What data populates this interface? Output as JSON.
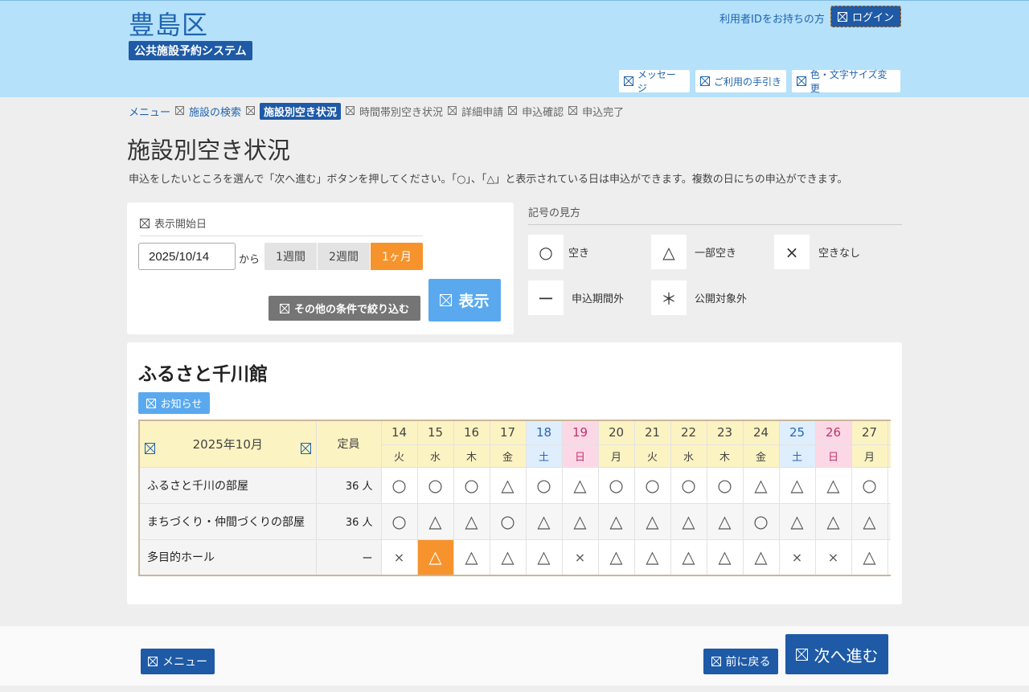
{
  "header": {
    "title": "豊島区",
    "subtitle": "公共施設予約システム",
    "userid_text": "利用者IDをお持ちの方",
    "login_label": "ログイン",
    "buttons": [
      "メッセージ",
      "ご利用の手引き",
      "色・文字サイズ変更"
    ]
  },
  "breadcrumb": [
    {
      "label": "メニュー",
      "state": "link"
    },
    {
      "label": "施設の検索",
      "state": "link"
    },
    {
      "label": "施設別空き状況",
      "state": "current"
    },
    {
      "label": "時間帯別空き状況",
      "state": "todo"
    },
    {
      "label": "詳細申請",
      "state": "todo"
    },
    {
      "label": "申込確認",
      "state": "todo"
    },
    {
      "label": "申込完了",
      "state": "todo"
    }
  ],
  "page": {
    "title": "施設別空き状況",
    "lead": "申込をしたいところを選んで「次へ進む」ボタンを押してください。「○」、「△」と表示されている日は申込ができます。複数の日にちの申込ができます。"
  },
  "date_panel": {
    "heading": "表示開始日",
    "date_value": "2025/10/14",
    "kara": "から",
    "periods": [
      {
        "label": "1週間",
        "active": false
      },
      {
        "label": "2週間",
        "active": false
      },
      {
        "label": "1ヶ月",
        "active": true
      }
    ],
    "filter_label": "その他の条件で絞り込む",
    "show_label": "表示"
  },
  "legend": {
    "title": "記号の見方",
    "items": [
      {
        "symbol": "○",
        "label": "空き"
      },
      {
        "symbol": "△",
        "label": "一部空き"
      },
      {
        "symbol": "×",
        "label": "空きなし"
      },
      {
        "symbol": "ー",
        "label": "申込期間外"
      },
      {
        "symbol": "＊",
        "label": "公開対象外"
      }
    ]
  },
  "facility": {
    "name": "ふるさと千川館",
    "notice_label": "お知らせ",
    "month_label": "2025年10月",
    "capacity_header": "定員",
    "days": [
      {
        "d": "14",
        "w": "火",
        "type": ""
      },
      {
        "d": "15",
        "w": "水",
        "type": ""
      },
      {
        "d": "16",
        "w": "木",
        "type": ""
      },
      {
        "d": "17",
        "w": "金",
        "type": ""
      },
      {
        "d": "18",
        "w": "土",
        "type": "sat"
      },
      {
        "d": "19",
        "w": "日",
        "type": "sun"
      },
      {
        "d": "20",
        "w": "月",
        "type": ""
      },
      {
        "d": "21",
        "w": "火",
        "type": ""
      },
      {
        "d": "22",
        "w": "水",
        "type": ""
      },
      {
        "d": "23",
        "w": "木",
        "type": ""
      },
      {
        "d": "24",
        "w": "金",
        "type": ""
      },
      {
        "d": "25",
        "w": "土",
        "type": "sat"
      },
      {
        "d": "26",
        "w": "日",
        "type": "sun"
      },
      {
        "d": "27",
        "w": "月",
        "type": ""
      },
      {
        "d": "",
        "w": "",
        "type": ""
      }
    ],
    "rows": [
      {
        "name": "ふるさと千川の部屋",
        "capacity": "36 人",
        "marks": [
          "○",
          "○",
          "○",
          "△",
          "○",
          "△",
          "○",
          "○",
          "○",
          "○",
          "△",
          "△",
          "△",
          "○",
          ""
        ]
      },
      {
        "name": "まちづくり・仲間づくりの部屋",
        "capacity": "36 人",
        "marks": [
          "○",
          "△",
          "△",
          "○",
          "△",
          "△",
          "△",
          "△",
          "△",
          "△",
          "○",
          "△",
          "△",
          "△",
          ""
        ]
      },
      {
        "name": "多目的ホール",
        "capacity": "ー",
        "marks": [
          "×",
          "△",
          "△",
          "△",
          "△",
          "×",
          "△",
          "△",
          "△",
          "△",
          "△",
          "×",
          "×",
          "△",
          ""
        ]
      }
    ],
    "selected": {
      "row": 2,
      "col": 1
    }
  },
  "footer": {
    "menu_label": "メニュー",
    "back_label": "前に戻る",
    "next_label": "次へ進む"
  }
}
